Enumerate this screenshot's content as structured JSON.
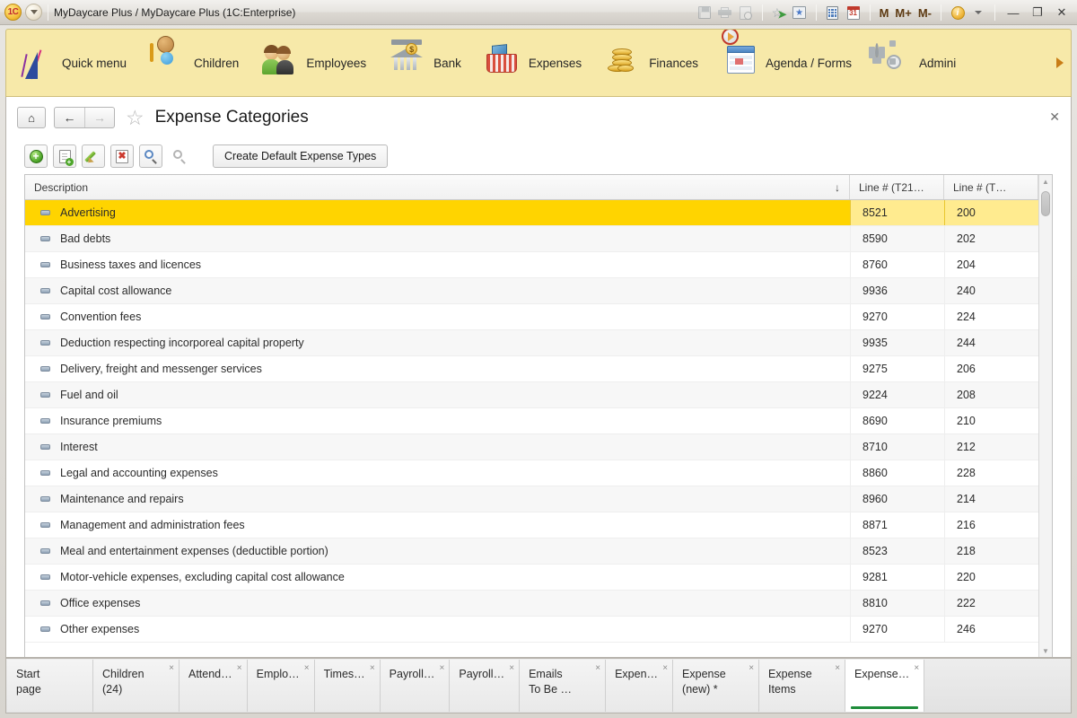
{
  "titlebar": {
    "app_title": "MyDaycare Plus / MyDaycare Plus  (1C:Enterprise)",
    "logo_text": "1C",
    "mem_buttons": [
      "M",
      "M+",
      "M-"
    ],
    "info_glyph": "i",
    "window_buttons": {
      "minimize": "—",
      "maximize": "❐",
      "close": "✕"
    }
  },
  "sections": [
    {
      "label": "Quick menu",
      "icon": "sail-logo-icon"
    },
    {
      "label": "Children",
      "icon": "toy-block-icon"
    },
    {
      "label": "Employees",
      "icon": "people-icon"
    },
    {
      "label": "Bank",
      "icon": "bank-icon"
    },
    {
      "label": "Expenses",
      "icon": "basket-icon"
    },
    {
      "label": "Finances",
      "icon": "coins-icon"
    },
    {
      "label": "Agenda / Forms",
      "icon": "calendar-clock-icon"
    },
    {
      "label": "Admini",
      "icon": "gear-icon"
    }
  ],
  "page": {
    "title": "Expense Categories",
    "home_glyph": "⌂",
    "back_glyph": "←",
    "forward_glyph": "→",
    "star_glyph": "☆",
    "close_glyph": "✕"
  },
  "commands": {
    "add_tooltip": "Create",
    "copy_tooltip": "Copy",
    "edit_tooltip": "Edit",
    "delete_tooltip": "Mark for deletion",
    "find_tooltip": "Find",
    "cancel_find_tooltip": "Cancel find",
    "default_types_label": "Create Default Expense Types",
    "plus_glyph": "+",
    "delete_glyph": "✖"
  },
  "table": {
    "columns": [
      {
        "key": "description",
        "label": "Description",
        "sort": "↓"
      },
      {
        "key": "line_t21",
        "label": "Line # (T21…"
      },
      {
        "key": "line_t",
        "label": "Line # (T…"
      }
    ],
    "rows": [
      {
        "description": "Advertising",
        "line_t21": "8521",
        "line_t": "200",
        "selected": true
      },
      {
        "description": "Bad debts",
        "line_t21": "8590",
        "line_t": "202",
        "selected": false
      },
      {
        "description": "Business taxes and licences",
        "line_t21": "8760",
        "line_t": "204",
        "selected": false
      },
      {
        "description": "Capital cost allowance",
        "line_t21": "9936",
        "line_t": "240",
        "selected": false
      },
      {
        "description": "Convention fees",
        "line_t21": "9270",
        "line_t": "224",
        "selected": false
      },
      {
        "description": "Deduction respecting incorporeal capital property",
        "line_t21": "9935",
        "line_t": "244",
        "selected": false
      },
      {
        "description": "Delivery, freight and messenger services",
        "line_t21": "9275",
        "line_t": "206",
        "selected": false
      },
      {
        "description": "Fuel and oil",
        "line_t21": "9224",
        "line_t": "208",
        "selected": false
      },
      {
        "description": "Insurance premiums",
        "line_t21": "8690",
        "line_t": "210",
        "selected": false
      },
      {
        "description": "Interest",
        "line_t21": "8710",
        "line_t": "212",
        "selected": false
      },
      {
        "description": "Legal and accounting expenses",
        "line_t21": "8860",
        "line_t": "228",
        "selected": false
      },
      {
        "description": "Maintenance and repairs",
        "line_t21": "8960",
        "line_t": "214",
        "selected": false
      },
      {
        "description": "Management and administration fees",
        "line_t21": "8871",
        "line_t": "216",
        "selected": false
      },
      {
        "description": "Meal and entertainment expenses (deductible portion)",
        "line_t21": "8523",
        "line_t": "218",
        "selected": false
      },
      {
        "description": "Motor-vehicle expenses, excluding capital cost allowance",
        "line_t21": "9281",
        "line_t": "220",
        "selected": false
      },
      {
        "description": "Office expenses",
        "line_t21": "8810",
        "line_t": "222",
        "selected": false
      },
      {
        "description": "Other expenses",
        "line_t21": "9270",
        "line_t": "246",
        "selected": false
      }
    ]
  },
  "taskbar": {
    "close_glyph": "×",
    "tabs": [
      {
        "line1": "Start",
        "line2": "page",
        "closable": false,
        "active": false
      },
      {
        "line1": "Children",
        "line2": "(24)",
        "closable": true,
        "active": false
      },
      {
        "line1": "Attend…",
        "line2": "",
        "closable": true,
        "active": false
      },
      {
        "line1": "Emplo…",
        "line2": "",
        "closable": true,
        "active": false
      },
      {
        "line1": "Times…",
        "line2": "",
        "closable": true,
        "active": false
      },
      {
        "line1": "Payroll…",
        "line2": "",
        "closable": true,
        "active": false
      },
      {
        "line1": "Payroll…",
        "line2": "",
        "closable": true,
        "active": false
      },
      {
        "line1": "Emails",
        "line2": "To Be …",
        "closable": true,
        "active": false
      },
      {
        "line1": "Expen…",
        "line2": "",
        "closable": true,
        "active": false
      },
      {
        "line1": "Expense",
        "line2": "(new) *",
        "closable": true,
        "active": false
      },
      {
        "line1": "Expense",
        "line2": "Items",
        "closable": true,
        "active": false
      },
      {
        "line1": "Expense…",
        "line2": "",
        "closable": true,
        "active": true
      }
    ]
  },
  "colors": {
    "section_bg": "#f7e9a9",
    "selection": "#ffd400",
    "selection_num": "#ffeb8f",
    "active_tab_underline": "#1e8c3a"
  }
}
